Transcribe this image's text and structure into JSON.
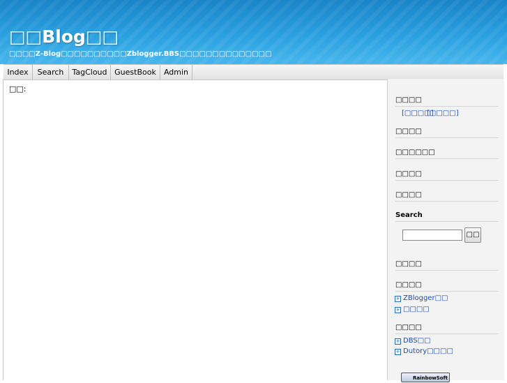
{
  "header": {
    "title": "□□Blog□□",
    "subtitle": "□□□□Z-Blog□□□□□□□□□□Zblogger.BBS□□□□□□□□□□□□□□"
  },
  "nav": {
    "items": [
      "Index",
      "Search",
      "TagCloud",
      "GuestBook",
      "Admin"
    ]
  },
  "main": {
    "label": "□□:"
  },
  "sidebar": {
    "section1_title": "□□□□",
    "section1_links": [
      "[□□□□]",
      "[□□□□]"
    ],
    "section2_title": "□□□□",
    "section3_title": "□□□□□□",
    "section4_title": "□□□□",
    "section5_title": "□□□□",
    "search_title": "Search",
    "search_placeholder": "",
    "search_button": "□□",
    "section7_title": "□□□□",
    "section8_title": "□□□□",
    "section8_links": [
      "ZBlogger□□",
      "□□□□"
    ],
    "section9_title": "□□□□",
    "section9_links": [
      "DBS□□",
      "Dutory□□□□"
    ],
    "badge_text": "RainbowSoft"
  },
  "colors": {
    "header_top": "#1a84c8",
    "header_bottom": "#47b6ec",
    "link": "#1a4bb5"
  }
}
